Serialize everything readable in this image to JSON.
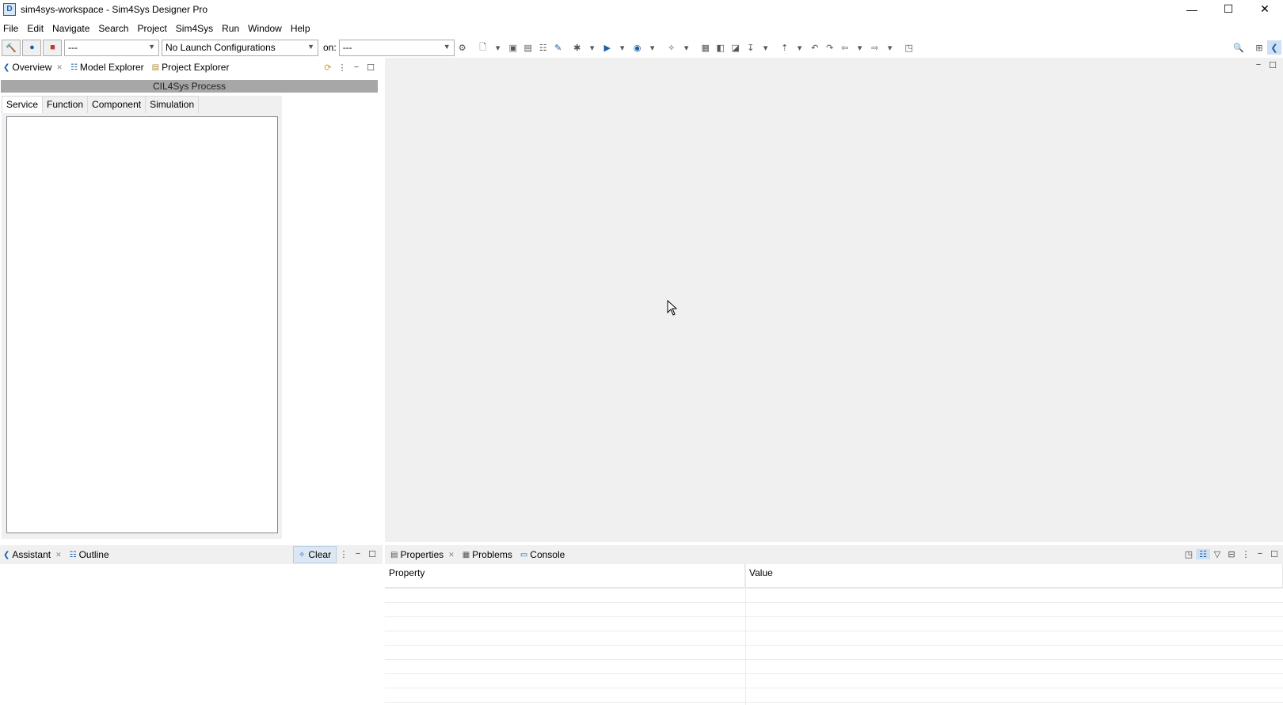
{
  "window": {
    "title": "sim4sys-workspace - Sim4Sys Designer Pro",
    "minimize": "—",
    "maximize": "☐",
    "close": "✕"
  },
  "menu": [
    "File",
    "Edit",
    "Navigate",
    "Search",
    "Project",
    "Sim4Sys",
    "Run",
    "Window",
    "Help"
  ],
  "toolbar": {
    "mode_combo": "---",
    "launch_combo": "No Launch Configurations",
    "on_label": "on:",
    "target_combo": "---"
  },
  "left_top": {
    "tabs": [
      {
        "label": "Overview",
        "icon": "overview-icon"
      },
      {
        "label": "Model Explorer",
        "icon": "model-explorer-icon"
      },
      {
        "label": "Project Explorer",
        "icon": "project-explorer-icon"
      }
    ],
    "process_title": "CIL4Sys Process",
    "inner_tabs": [
      "Service",
      "Function",
      "Component",
      "Simulation"
    ],
    "active_inner_tab": "Service"
  },
  "left_bottom": {
    "tabs": [
      {
        "label": "Assistant",
        "icon": "assistant-icon"
      },
      {
        "label": "Outline",
        "icon": "outline-icon"
      }
    ],
    "clear_label": "Clear"
  },
  "properties": {
    "tabs": [
      {
        "label": "Properties",
        "icon": "properties-icon"
      },
      {
        "label": "Problems",
        "icon": "problems-icon"
      },
      {
        "label": "Console",
        "icon": "console-icon"
      }
    ],
    "columns": [
      "Property",
      "Value"
    ]
  },
  "colors": {
    "accent": "#1b5fa8",
    "panel_bg": "#f0f0f0",
    "process_bar": "#a7a7a7"
  }
}
